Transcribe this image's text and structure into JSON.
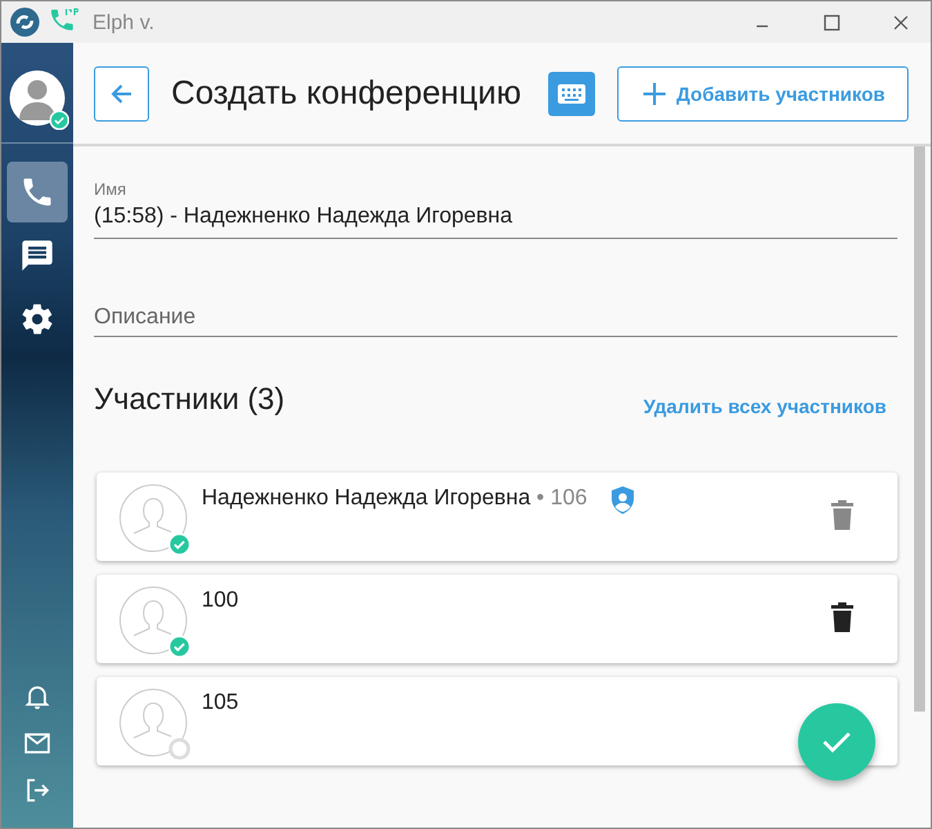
{
  "window": {
    "title": "Elph v."
  },
  "sidebar": {
    "items": [
      {
        "kind": "phone",
        "selected": true
      },
      {
        "kind": "chat",
        "selected": false
      },
      {
        "kind": "settings",
        "selected": false
      }
    ],
    "bottom": [
      {
        "kind": "bell"
      },
      {
        "kind": "mail"
      },
      {
        "kind": "logout"
      }
    ],
    "user": {
      "online": true
    }
  },
  "header": {
    "title": "Создать конференцию",
    "add_button": "Добавить участников"
  },
  "form": {
    "name": {
      "label": "Имя",
      "value": "(15:58) - Надежненко Надежда Игоревна"
    },
    "description": {
      "placeholder": "Описание"
    }
  },
  "participants": {
    "heading": "Участники (3)",
    "remove_all": "Удалить всех участников",
    "items": [
      {
        "name": "Надежненко Надежда Игоревна",
        "number": "• 106",
        "online": true,
        "admin": true,
        "delete": {
          "hovered": false
        }
      },
      {
        "name": "100",
        "online": true,
        "admin": false,
        "delete": {
          "hovered": true
        }
      },
      {
        "name": "105",
        "online": false,
        "admin": false
      }
    ]
  }
}
